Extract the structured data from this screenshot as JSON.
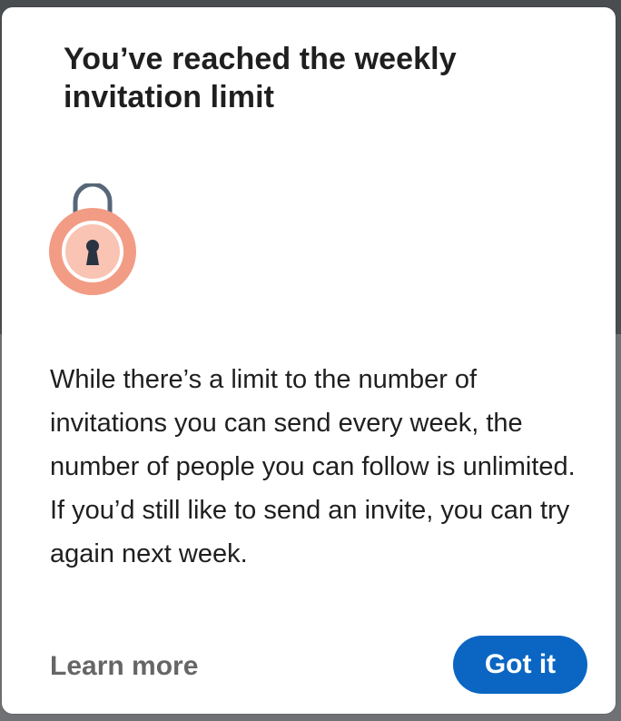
{
  "modal": {
    "title": "You’ve reached the weekly invitation limit",
    "icon": "lock-icon",
    "body": "While there’s a limit to the number of invitations you can send every week, the number of people you can follow is unlimited. If you’d still like to send an invite, you can try again next week.",
    "learn_more_label": "Learn more",
    "confirm_label": "Got it"
  },
  "colors": {
    "primary_button": "#0a66c2",
    "lock_outer": "#f29c85",
    "lock_inner": "#f9c4b3",
    "shackle": "#566778"
  }
}
